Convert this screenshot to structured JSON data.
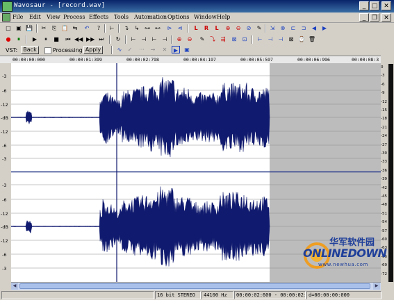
{
  "window": {
    "title": "Wavosaur - [record.wav]",
    "min_label": "_",
    "max_label": "□",
    "close_label": "✕"
  },
  "menu": [
    "File",
    "Edit",
    "View",
    "Process",
    "Effects",
    "Tools",
    "Automation",
    "Options",
    "Window",
    "Help"
  ],
  "doc_controls": {
    "min_label": "_",
    "restore_label": "❐",
    "close_label": "✕"
  },
  "toolbar1": [
    "□",
    "▣",
    "💾",
    "✂",
    "⎘",
    "📋",
    "⇆",
    "↶",
    "?",
    "⊢",
    "↴",
    "↳",
    "⊶",
    "⊷",
    "⊳",
    "⊲",
    "L",
    "R",
    "L",
    "⊕",
    "⊖",
    "⊘",
    "✎",
    "⇲",
    "⊗",
    "⊏",
    "⊐",
    "◇",
    "⊡",
    "◆",
    "◀",
    "▶"
  ],
  "toolbar2": [
    "●",
    "⏸",
    "▶",
    "⏸",
    "■",
    "⏮",
    "◀◀",
    "▶▶",
    "⏭",
    "↻",
    "⊢",
    "⊣",
    "⊢",
    "⊣",
    "⊕",
    "⊖",
    "✎",
    "⤵",
    "⇶",
    "⊠",
    "⊡",
    "⊢",
    "⊣",
    "⊣",
    "⊠",
    "⌚",
    "🗑"
  ],
  "vst": {
    "label": "VST:",
    "back_label": "Back",
    "processing_label": "Processing",
    "apply_label": "Apply"
  },
  "timeline": [
    "00:00:00:000",
    "00:00:01:399",
    "00:00:02:798",
    "00:00:04:197",
    "00:00:05:597",
    "00:00:06:996",
    "00:00:08:3"
  ],
  "left_axis": [
    "-3",
    "-6",
    "-12",
    "-dB",
    "-12",
    "-6",
    "-3",
    "-3",
    "-6",
    "-12",
    "-dB",
    "-12",
    "-6",
    "-3"
  ],
  "right_axis": [
    "0",
    "-3",
    "-6",
    "-9",
    "-12",
    "-15",
    "-18",
    "-21",
    "-24",
    "-27",
    "-30",
    "-33",
    "-36",
    "-39",
    "-42",
    "-45",
    "-48",
    "-51",
    "-54",
    "-57",
    "-60",
    "-63",
    "-66",
    "-69",
    "-72"
  ],
  "status": {
    "format": "16 bit STEREO",
    "rate": "44100 Hz",
    "position": "00:00:02:600 - 00:00:02:f",
    "duration": "d=00:00:00:000",
    "empty": ""
  },
  "watermark": {
    "top": "华军软件园",
    "brand": "ONLINEDOWN",
    "url": "www.newhua.com"
  },
  "colors": {
    "wave": "#101a6e",
    "selection": "#bcbcbc",
    "title_start": "#0a246a",
    "title_end": "#3a6ea5"
  }
}
